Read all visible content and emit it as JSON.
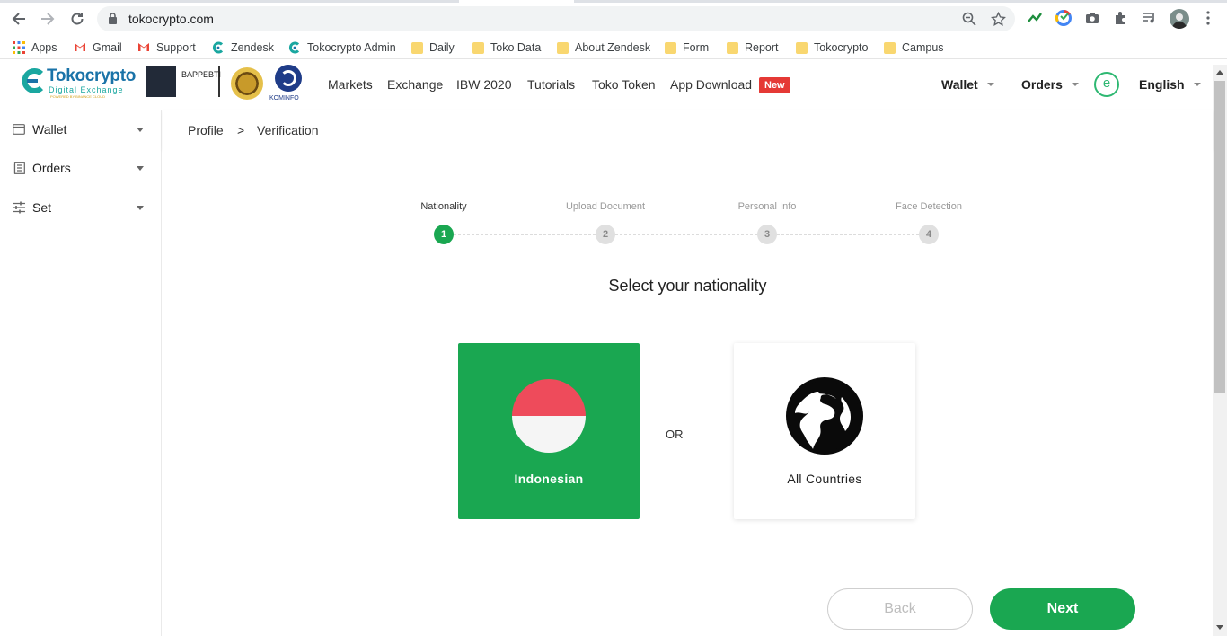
{
  "browser": {
    "url": "tokocrypto.com",
    "bookmarks": [
      "Apps",
      "Gmail",
      "Support",
      "Zendesk",
      "Tokocrypto Admin",
      "Daily",
      "Toko Data",
      "About Zendesk",
      "Form",
      "Report",
      "Tokocrypto",
      "Campus"
    ]
  },
  "header": {
    "logo_title": "Tokocrypto",
    "logo_subtitle": "Digital Exchange",
    "logo_tagline": "POWERED BY BINANCE CLOUD",
    "partner_bappebti": "BAPPEBTI",
    "partner_kominfo": "KOMINFO",
    "nav": [
      "Markets",
      "Exchange",
      "IBW 2020",
      "Tutorials",
      "Toko Token",
      "App Download"
    ],
    "new_badge": "New",
    "wallet": "Wallet",
    "orders": "Orders",
    "avatar_letter": "e",
    "language": "English"
  },
  "sidebar": {
    "items": [
      {
        "label": "Wallet",
        "icon": "wallet-icon"
      },
      {
        "label": "Orders",
        "icon": "orders-icon"
      },
      {
        "label": "Set",
        "icon": "settings-sliders-icon"
      }
    ]
  },
  "breadcrumb": {
    "items": [
      "Profile",
      "Verification"
    ],
    "separator": ">"
  },
  "steps": [
    {
      "label": "Nationality",
      "number": "1",
      "active": true
    },
    {
      "label": "Upload Document",
      "number": "2",
      "active": false
    },
    {
      "label": "Personal Info",
      "number": "3",
      "active": false
    },
    {
      "label": "Face Detection",
      "number": "4",
      "active": false
    }
  ],
  "main": {
    "heading": "Select your nationality",
    "option_indonesian": "Indonesian",
    "or_label": "OR",
    "option_all": "All Countries",
    "back_button": "Back",
    "next_button": "Next"
  },
  "colors": {
    "accent_green": "#1aa751",
    "flag_red": "#ee4b5b",
    "badge_red": "#e53935"
  }
}
